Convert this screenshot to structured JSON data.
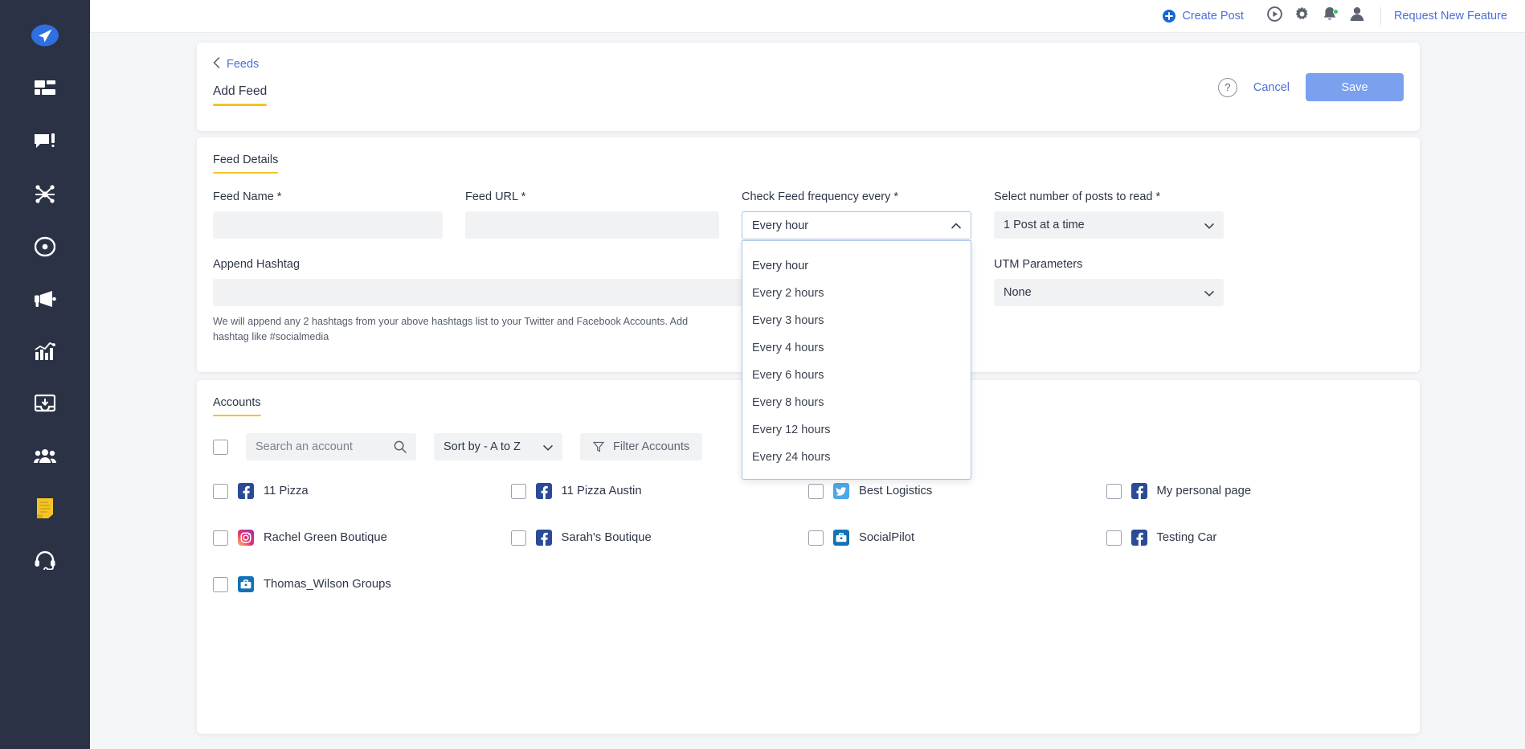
{
  "sidebar": {
    "logo_icon": "paper-plane-logo",
    "items": [
      {
        "icon": "dashboard-icon",
        "name": "dashboard",
        "active": false
      },
      {
        "icon": "compose-post-icon",
        "name": "compose",
        "active": false
      },
      {
        "icon": "network-share-icon",
        "name": "network",
        "active": false
      },
      {
        "icon": "discovery-icon",
        "name": "discovery",
        "active": false
      },
      {
        "icon": "megaphone-icon",
        "name": "campaigns",
        "active": false
      },
      {
        "icon": "analytics-bar-chart-icon",
        "name": "analytics",
        "active": false
      },
      {
        "icon": "inbox-download-icon",
        "name": "inbox",
        "active": false
      },
      {
        "icon": "team-people-icon",
        "name": "team",
        "active": false
      },
      {
        "icon": "feeds-document-icon",
        "name": "feeds",
        "active": true
      },
      {
        "icon": "headset-support-icon",
        "name": "support",
        "active": false
      }
    ],
    "active_color": "#f6c426",
    "background": "#2b3245"
  },
  "topbar": {
    "create_post_label": "Create Post",
    "create_post_icon": "plus-circle-icon",
    "icons": [
      {
        "name": "play-video-icon"
      },
      {
        "name": "gear-settings-icon"
      },
      {
        "name": "bell-notification-icon",
        "badge": true
      },
      {
        "name": "user-profile-icon"
      }
    ],
    "request_feature_label": "Request New Feature",
    "link_color": "#4b6fd6",
    "badge_color": "#3ac06a"
  },
  "header_card": {
    "breadcrumb_label": "Feeds",
    "breadcrumb_icon": "chevron-left-icon",
    "page_tab_label": "Add Feed",
    "help_icon": "question-mark-icon",
    "cancel_label": "Cancel",
    "save_label": "Save",
    "save_color": "#7aa0ee",
    "underline_color": "#f6c426"
  },
  "feed_details": {
    "section_title": "Feed Details",
    "feed_name": {
      "label": "Feed Name",
      "required": "*",
      "value": "",
      "placeholder": ""
    },
    "feed_url": {
      "label": "Feed URL",
      "required": "*",
      "value": "",
      "placeholder": ""
    },
    "frequency": {
      "label": "Check Feed frequency every",
      "required": "*",
      "selected": "Every hour",
      "expanded": true,
      "chevron_icon": "chevron-up-icon",
      "options": [
        "Every hour",
        "Every 2 hours",
        "Every 3 hours",
        "Every 4 hours",
        "Every 6 hours",
        "Every 8 hours",
        "Every 12 hours",
        "Every 24 hours"
      ]
    },
    "posts_to_read": {
      "label": "Select number of posts to read",
      "required": "*",
      "selected": "1 Post at a time",
      "chevron_icon": "chevron-down-icon"
    },
    "append_hashtag": {
      "label": "Append Hashtag",
      "value": "",
      "placeholder": "",
      "hint": "We will append any 2 hashtags from your above hashtags list to your Twitter and Facebook Accounts. Add hashtag like #socialmedia"
    },
    "utm_parameters": {
      "label": "UTM Parameters",
      "selected": "None",
      "chevron_icon": "chevron-down-icon"
    }
  },
  "accounts": {
    "section_title": "Accounts",
    "select_all_checked": false,
    "search": {
      "placeholder": "Search an account",
      "value": "",
      "icon": "search-icon"
    },
    "sort_by": {
      "selected": "Sort by - A to Z",
      "chevron_icon": "chevron-down-icon"
    },
    "filter": {
      "label": "Filter Accounts",
      "icon": "funnel-filter-icon"
    },
    "items": [
      {
        "name": "11 Pizza",
        "network": "facebook",
        "checked": false
      },
      {
        "name": "11 Pizza Austin",
        "network": "facebook",
        "checked": false
      },
      {
        "name": "Best Logistics",
        "network": "twitter",
        "checked": false
      },
      {
        "name": "My personal page",
        "network": "facebook",
        "checked": false
      },
      {
        "name": "Rachel Green Boutique",
        "network": "instagram",
        "checked": false
      },
      {
        "name": "Sarah's Boutique",
        "network": "facebook",
        "checked": false
      },
      {
        "name": "SocialPilot",
        "network": "linkedin",
        "checked": false
      },
      {
        "name": "Testing Car",
        "network": "facebook",
        "checked": false
      },
      {
        "name": "Thomas_Wilson Groups",
        "network": "linkedin",
        "checked": false
      }
    ],
    "network_colors": {
      "facebook": "#2b4a97",
      "twitter": "#4aa7e8",
      "instagram": "#e1306c",
      "linkedin": "#1272b5"
    }
  }
}
